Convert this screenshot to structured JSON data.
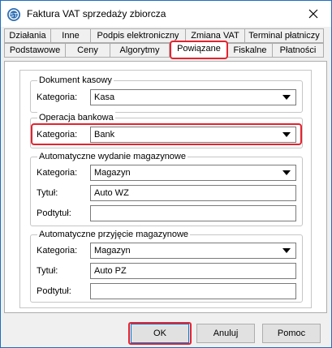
{
  "window": {
    "title": "Faktura VAT sprzedaży zbiorcza"
  },
  "tabs": {
    "row1": [
      "Działania",
      "Inne",
      "Podpis elektroniczny",
      "Zmiana VAT",
      "Terminal płatniczy"
    ],
    "row2": [
      "Podstawowe",
      "Ceny",
      "Algorytmy",
      "Powiązane",
      "Fiskalne",
      "Płatności"
    ],
    "active": "Powiązane"
  },
  "groups": {
    "dokument_kasowy": {
      "title": "Dokument kasowy",
      "kategoria_label": "Kategoria:",
      "kategoria_value": "Kasa"
    },
    "operacja_bankowa": {
      "title": "Operacja bankowa",
      "kategoria_label": "Kategoria:",
      "kategoria_value": "Bank"
    },
    "wydanie": {
      "title": "Automatyczne wydanie magazynowe",
      "kategoria_label": "Kategoria:",
      "kategoria_value": "Magazyn",
      "tytul_label": "Tytuł:",
      "tytul_value": "Auto WZ",
      "podtytul_label": "Podtytuł:",
      "podtytul_value": ""
    },
    "przyjecie": {
      "title": "Automatyczne przyjęcie magazynowe",
      "kategoria_label": "Kategoria:",
      "kategoria_value": "Magazyn",
      "tytul_label": "Tytuł:",
      "tytul_value": "Auto PZ",
      "podtytul_label": "Podtytuł:",
      "podtytul_value": ""
    }
  },
  "buttons": {
    "ok": "OK",
    "cancel": "Anuluj",
    "help": "Pomoc"
  },
  "colors": {
    "highlight": "#e5222e",
    "window_border": "#1e6fc0",
    "default_button_border": "#0078d7"
  },
  "icons": {
    "app": "invoice-app-icon",
    "close": "close-icon",
    "dropdown": "chevron-down-icon"
  }
}
